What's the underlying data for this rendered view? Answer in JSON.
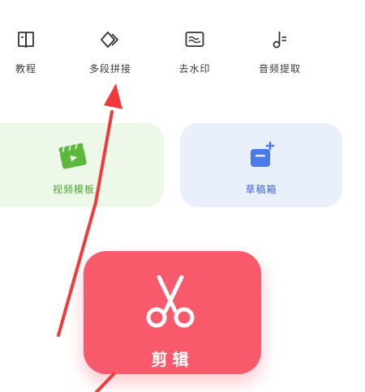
{
  "tools": [
    {
      "label": "教程",
      "icon": "book-icon"
    },
    {
      "label": "多段拼接",
      "icon": "multi-segment-icon"
    },
    {
      "label": "去水印",
      "icon": "watermark-icon"
    },
    {
      "label": "音频提取",
      "icon": "audio-note-icon"
    }
  ],
  "cards": {
    "template": {
      "label": "视频模板",
      "icon": "video-template-icon",
      "color": "#5cb83a"
    },
    "drafts": {
      "label": "草稿箱",
      "icon": "drafts-box-icon",
      "color": "#4a7be8"
    }
  },
  "edit": {
    "label": "剪辑",
    "icon": "scissors-icon",
    "color": "#f8596b"
  },
  "annotation": {
    "color": "#f03a3a"
  }
}
